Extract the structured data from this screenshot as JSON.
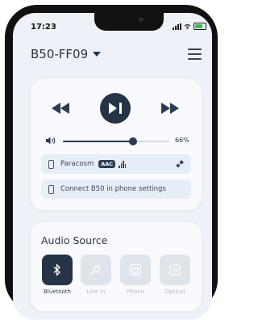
{
  "status_bar": {
    "time": "17:23"
  },
  "header": {
    "device_name": "B50-FF09"
  },
  "player": {
    "volume_label": "66%",
    "volume_fraction": 0.66
  },
  "connection": {
    "device": "Paracosm",
    "codec": "AAC",
    "hint": "Connect B50 in phone settings"
  },
  "audio_source": {
    "title": "Audio Source",
    "options": [
      {
        "label": "Bluetooth",
        "icon": "bluetooth-icon",
        "active": true
      },
      {
        "label": "Line in",
        "icon": "line-in-icon",
        "active": false
      },
      {
        "label": "Phono",
        "icon": "phono-icon",
        "active": false
      },
      {
        "label": "Optical",
        "icon": "optical-icon",
        "active": false
      }
    ]
  },
  "colors": {
    "accent": "#263447",
    "background": "#eef2f8",
    "card": "#f8fafd"
  }
}
